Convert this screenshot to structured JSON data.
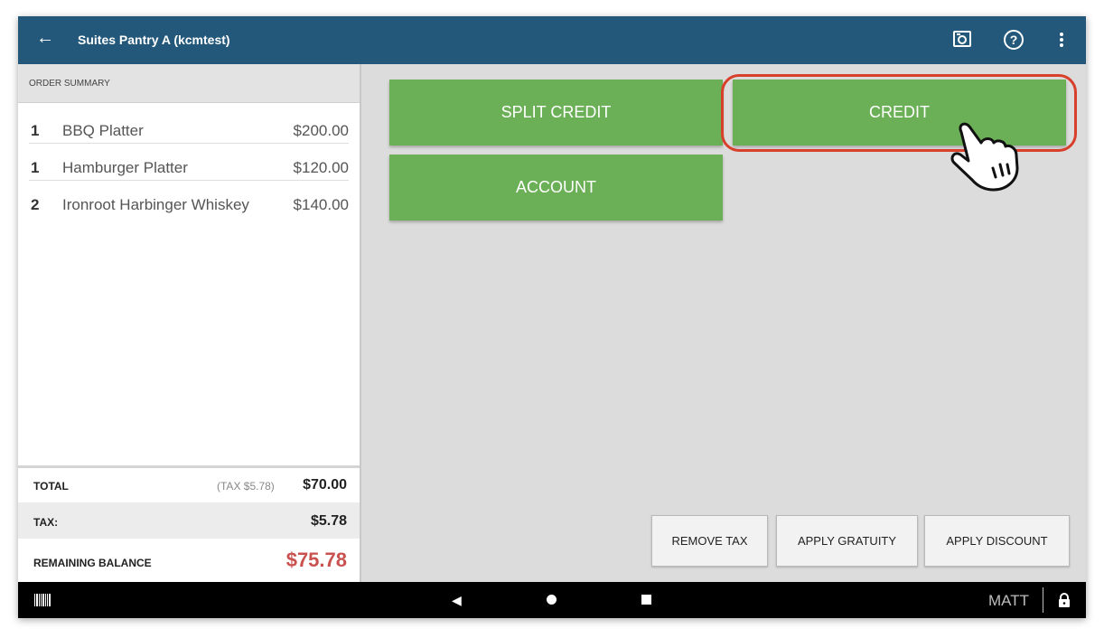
{
  "header": {
    "title": "Suites Pantry A (kcmtest)",
    "back_icon": "arrow-left-icon",
    "icons": [
      "camera-icon",
      "help-icon",
      "more-vert-icon"
    ]
  },
  "order_summary": {
    "heading": "ORDER SUMMARY",
    "items": [
      {
        "qty": "1",
        "name": "BBQ Platter",
        "price": "$200.00"
      },
      {
        "qty": "1",
        "name": "Hamburger Platter",
        "price": "$120.00"
      },
      {
        "qty": "2",
        "name": "Ironroot Harbinger Whiskey",
        "price": "$140.00"
      }
    ],
    "total_label": "TOTAL",
    "total_tax_note": "(TAX  $5.78)",
    "total_value": "$70.00",
    "tax_label": "TAX:",
    "tax_value": "$5.78",
    "remaining_label": "REMAINING BALANCE",
    "remaining_value": "$75.78"
  },
  "payment": {
    "split_credit": "SPLIT CREDIT",
    "credit": "CREDIT",
    "account": "ACCOUNT"
  },
  "actions": {
    "remove_tax": "REMOVE TAX",
    "apply_gratuity": "APPLY GRATUITY",
    "apply_discount": "APPLY DISCOUNT"
  },
  "navbar": {
    "user": "MATT"
  },
  "colors": {
    "header": "#24587a",
    "pay_button": "#6bb056",
    "highlight": "#d8402c",
    "balance": "#c9514f"
  }
}
